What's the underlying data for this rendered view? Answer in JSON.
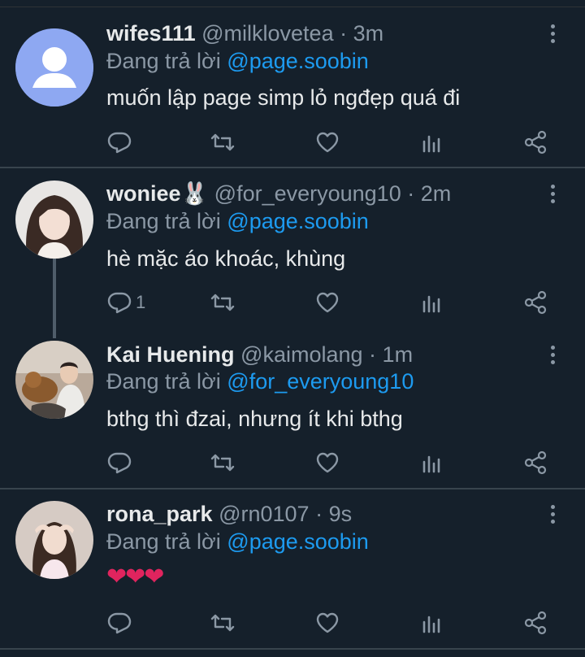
{
  "app": "Twitter replies",
  "colors": {
    "background": "#15202b",
    "accent": "#1d9bf0",
    "muted": "#8b98a5",
    "text": "#e7e9ea"
  },
  "tweets": [
    {
      "name": "wifes111",
      "handle": "@milklovetea",
      "dot": "·",
      "time": "3m",
      "reply_prefix": "Đang trả lời",
      "reply_to": "@page.soobin",
      "text": "muốn lập page simp lỏ ngđẹp quá đi",
      "reply_count": ""
    },
    {
      "name": "woniee🐰",
      "handle": "@for_everyoung10",
      "dot": "·",
      "time": "2m",
      "reply_prefix": "Đang trả lời",
      "reply_to": "@page.soobin",
      "text": "hè mặc áo khoác, khùng",
      "reply_count": "1"
    },
    {
      "name": "Kai Huening",
      "handle": "@kaimolang",
      "dot": "·",
      "time": "1m",
      "reply_prefix": "Đang trả lời",
      "reply_to": "@for_everyoung10",
      "text": "bthg thì đzai, nhưng ít khi bthg",
      "reply_count": ""
    },
    {
      "name": "rona_park",
      "handle": "@rn0107",
      "dot": "·",
      "time": "9s",
      "reply_prefix": "Đang trả lời",
      "reply_to": "@page.soobin",
      "text": "❤❤❤",
      "reply_count": ""
    }
  ],
  "icons": {
    "reply": "reply-icon",
    "retweet": "retweet-icon",
    "like": "heart-icon",
    "analytics": "analytics-icon",
    "share": "share-icon",
    "more": "more-vertical-icon"
  }
}
